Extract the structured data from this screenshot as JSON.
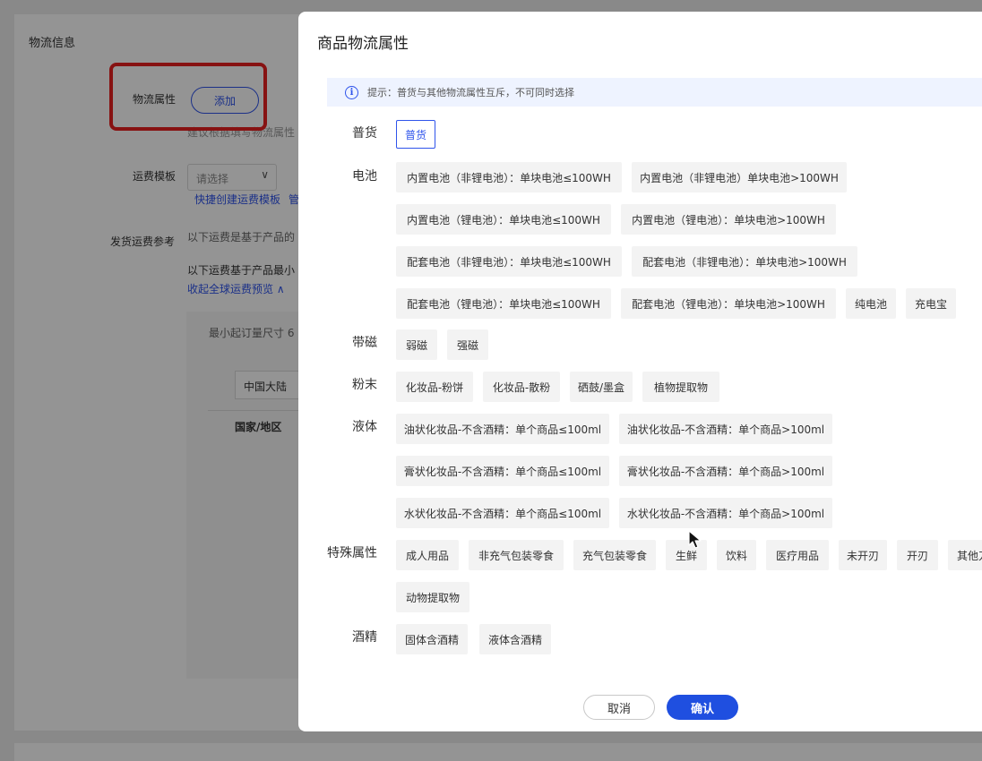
{
  "background": {
    "section_title": "物流信息",
    "logistics_attr_label": "物流属性",
    "add_button": "添加",
    "logistics_hint": "建议根据填写物流属性",
    "freight_template_label": "运费模板",
    "freight_select_placeholder": "请选择",
    "quick_create_link": "快捷创建运费模板",
    "manage_link": "管",
    "shipping_ref_label": "发货运费参考",
    "shipping_ref_text1": "以下运费是基于产品的",
    "shipping_ref_text2": "以下运费基于产品最小",
    "collapse_link": "收起全球运费预览 ∧",
    "min_order_label": "最小起订量尺寸 6",
    "region_value": "中国大陆",
    "column_country": "国家/地区"
  },
  "modal": {
    "title": "商品物流属性",
    "hint": "提示：普货与其他物流属性互斥，不可同时选择",
    "rows": [
      {
        "label": "普货",
        "tags": [
          "普货"
        ]
      },
      {
        "label": "电池",
        "tags": [
          "内置电池（非锂电池）：单块电池≤100WH",
          "内置电池（非锂电池）单块电池>100WH",
          "内置电池（锂电池）：单块电池≤100WH",
          "内置电池（锂电池）：单块电池>100WH",
          "配套电池（非锂电池）：单块电池≤100WH",
          "配套电池（非锂电池）：单块电池>100WH",
          "配套电池（锂电池）：单块电池≤100WH",
          "配套电池（锂电池）：单块电池>100WH",
          "纯电池",
          "充电宝"
        ]
      },
      {
        "label": "带磁",
        "tags": [
          "弱磁",
          "强磁"
        ]
      },
      {
        "label": "粉末",
        "tags": [
          "化妆品-粉饼",
          "化妆品-散粉",
          "硒鼓/墨盒",
          "植物提取物"
        ]
      },
      {
        "label": "液体",
        "tags": [
          "油状化妆品-不含酒精：单个商品≤100ml",
          "油状化妆品-不含酒精：单个商品>100ml",
          "膏状化妆品-不含酒精：单个商品≤100ml",
          "膏状化妆品-不含酒精：单个商品>100ml",
          "水状化妆品-不含酒精：单个商品≤100ml",
          "水状化妆品-不含酒精：单个商品>100ml"
        ]
      },
      {
        "label": "特殊属性",
        "tags": [
          "成人用品",
          "非充气包装零食",
          "充气包装零食",
          "生鲜",
          "饮料",
          "医疗用品",
          "未开刃",
          "开刃",
          "其他刀",
          "动物提取物"
        ]
      },
      {
        "label": "酒精",
        "tags": [
          "固体含酒精",
          "液体含酒精"
        ]
      }
    ],
    "selected_tag": "普货",
    "cancel_button": "取消",
    "confirm_button": "确认"
  },
  "colors": {
    "accent": "#1f4fe0",
    "highlight_box": "#e82020",
    "hint_bg": "#eef3ff"
  }
}
